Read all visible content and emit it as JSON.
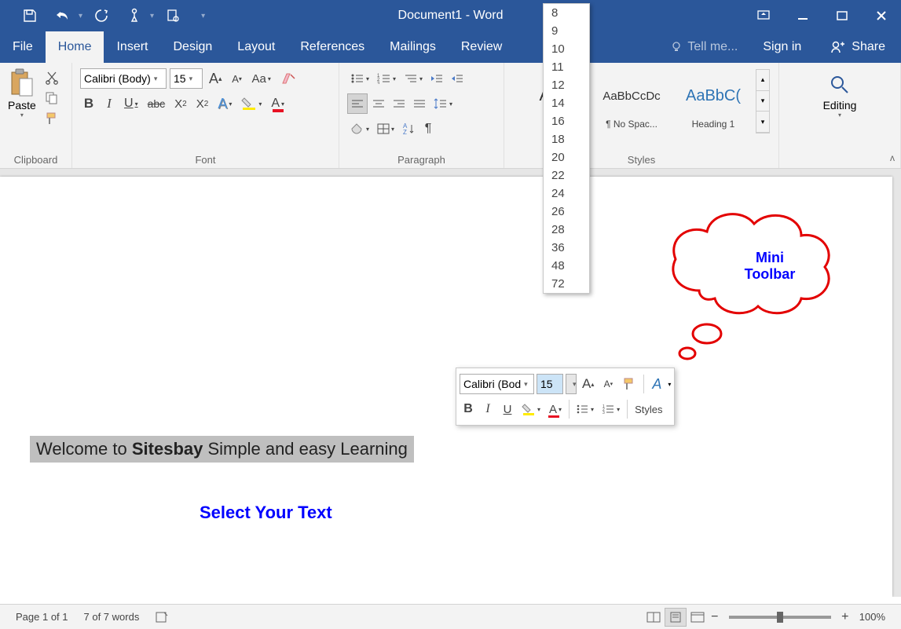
{
  "title": "Document1 - Word",
  "menu": {
    "file": "File",
    "home": "Home",
    "insert": "Insert",
    "design": "Design",
    "layout": "Layout",
    "references": "References",
    "mailings": "Mailings",
    "review": "Review",
    "tellme": "Tell me...",
    "signin": "Sign in",
    "share": "Share"
  },
  "ribbon": {
    "clipboard": {
      "label": "Clipboard",
      "paste": "Paste"
    },
    "font": {
      "label": "Font",
      "family": "Calibri (Body)",
      "size": "15",
      "case": "Aa"
    },
    "paragraph": {
      "label": "Paragraph"
    },
    "styles": {
      "label": "Styles",
      "items": [
        {
          "preview": "Aa",
          "name": ""
        },
        {
          "preview": "AaBbCcDc",
          "name": "¶ No Spac..."
        },
        {
          "preview": "AaBbC(",
          "name": "Heading 1"
        }
      ]
    },
    "editing": {
      "label": "Editing"
    }
  },
  "font_sizes": [
    "8",
    "9",
    "10",
    "11",
    "12",
    "14",
    "16",
    "18",
    "20",
    "22",
    "24",
    "26",
    "28",
    "36",
    "48",
    "72"
  ],
  "mini": {
    "font": "Calibri (Bod",
    "size": "15",
    "styles": "Styles"
  },
  "document": {
    "line_pre": "Welcome to ",
    "line_bold": "Sitesbay",
    "line_post": " Simple and easy Learning",
    "annotation": "Select Your Text",
    "callout_l1": "Mini",
    "callout_l2": "Toolbar"
  },
  "status": {
    "page": "Page 1 of 1",
    "words": "7 of 7 words",
    "zoom": "100%"
  }
}
